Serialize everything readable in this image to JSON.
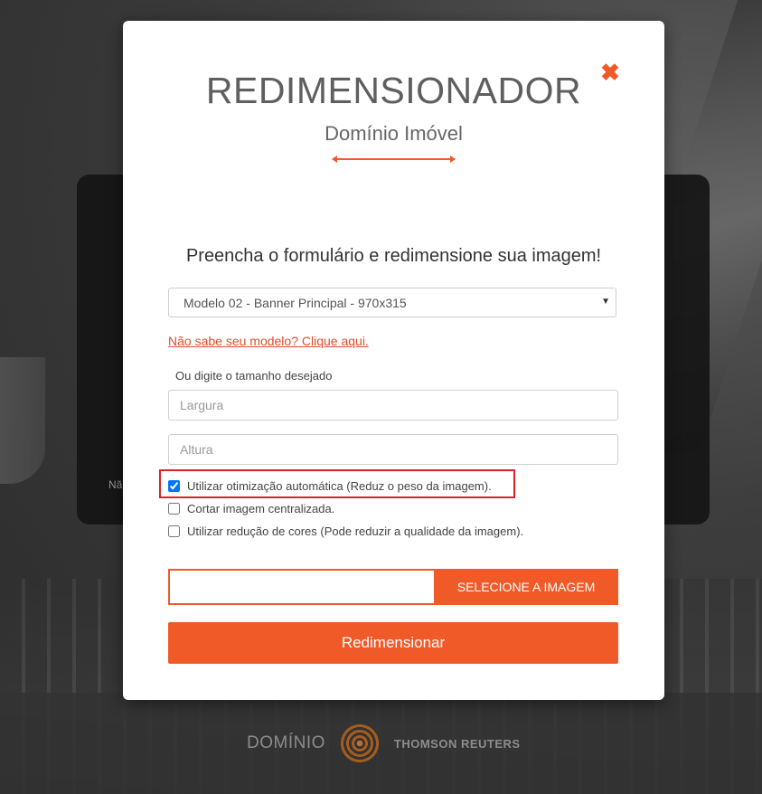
{
  "modal": {
    "title": "REDIMENSIONADOR",
    "subtitle": "Domínio Imóvel",
    "close_icon": "close-icon",
    "close_glyph": "✖"
  },
  "form": {
    "heading": "Preencha o formulário e redimensione sua imagem!",
    "model_select": {
      "selected": "Modelo 02 - Banner Principal - 970x315"
    },
    "help_link": "Não sabe seu modelo? Clique aqui.",
    "size_label": "Ou digite o tamanho desejado",
    "width_placeholder": "Largura",
    "height_placeholder": "Altura",
    "options": [
      {
        "label": "Utilizar otimização automática (Reduz o peso da imagem).",
        "checked": true
      },
      {
        "label": "Cortar imagem centralizada.",
        "checked": false
      },
      {
        "label": "Utilizar redução de cores (Pode reduzir a qualidade da imagem).",
        "checked": false
      }
    ],
    "select_image_label": "SELECIONE A IMAGEM",
    "submit_label": "Redimensionar"
  },
  "background": {
    "panel_text": "Nã",
    "footer_brand_left": "DOMÍNIO",
    "footer_brand_right": "THOMSON REUTERS"
  },
  "colors": {
    "accent": "#f05a28",
    "highlight": "#e0202a"
  }
}
